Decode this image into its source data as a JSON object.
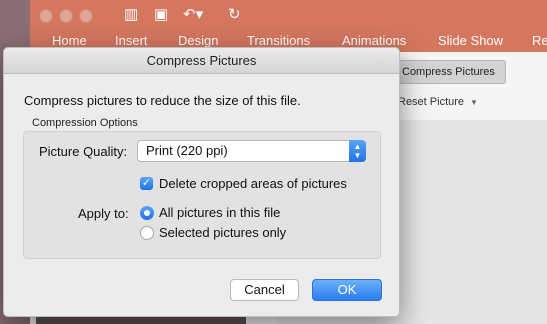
{
  "app": {
    "quick_access": [
      "sidebar-icon",
      "save-icon",
      "undo-icon",
      "redo-icon"
    ],
    "tabs": [
      "Home",
      "Insert",
      "Design",
      "Transitions",
      "Animations",
      "Slide Show",
      "Re"
    ],
    "ribbon": {
      "compress_label": "Compress Pictures",
      "reset_label": "Reset Picture"
    },
    "colors": {
      "ribbon": "#d5765f",
      "accent": "#2a7df0"
    }
  },
  "dialog": {
    "title": "Compress Pictures",
    "description": "Compress pictures to reduce the size of this file.",
    "group_label": "Compression Options",
    "picture_quality_label": "Picture Quality:",
    "picture_quality_value": "Print (220 ppi)",
    "delete_cropped_label": "Delete cropped areas of pictures",
    "delete_cropped_checked": true,
    "apply_to_label": "Apply to:",
    "apply_options": [
      "All pictures in this file",
      "Selected pictures only"
    ],
    "apply_selected": 0,
    "cancel_label": "Cancel",
    "ok_label": "OK"
  }
}
